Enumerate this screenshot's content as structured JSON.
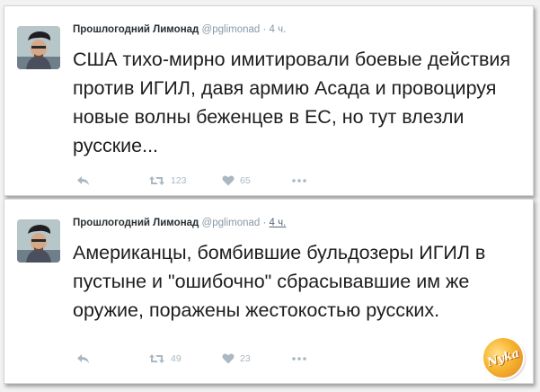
{
  "tweets": [
    {
      "name": "Прошлогодний Лимонад",
      "handle": "@pglimonad",
      "sep": "·",
      "time": "4 ч.",
      "text": "США тихо-мирно имитировали боевые действия против ИГИЛ, давя армию Асада и провоцируя новые волны беженцев в ЕС, но тут влезли русские...",
      "retweets": "123",
      "likes": "65"
    },
    {
      "name": "Прошлогодний Лимонад",
      "handle": "@pglimonad",
      "sep": "·",
      "time": "4 ч.",
      "text": "Американцы, бомбившие бульдозеры ИГИЛ в пустыне и \"ошибочно\" сбрасывавшие им же оружие, поражены жестокостью русских.",
      "retweets": "49",
      "likes": "23"
    }
  ],
  "watermark": "Nyka",
  "icons": [
    "reply-icon",
    "retweet-icon",
    "like-icon",
    "more-icon"
  ],
  "colors": {
    "action_gray": "#aab8c2",
    "watermark_orange": "#f7b531"
  }
}
